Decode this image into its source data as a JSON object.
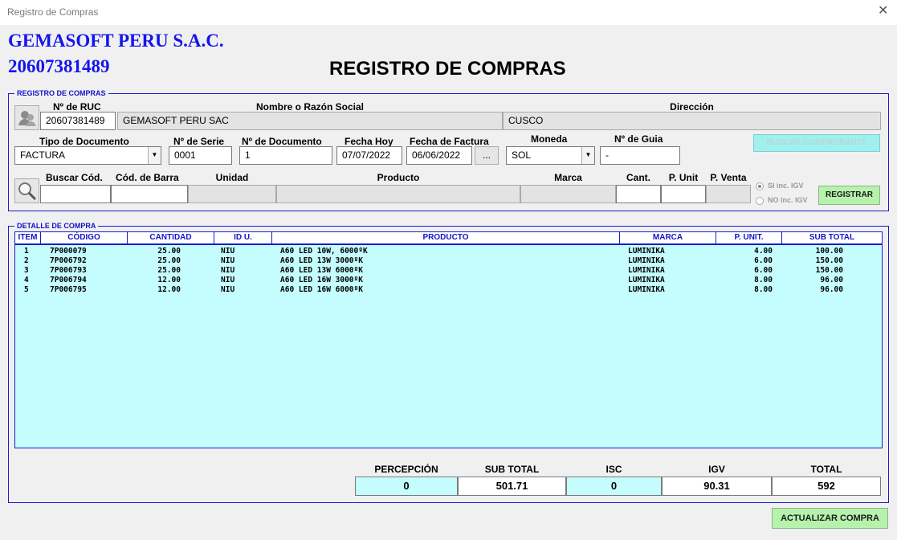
{
  "window": {
    "title": "Registro de Compras"
  },
  "header": {
    "company": "GEMASOFT PERU S.A.C.",
    "ruc": "20607381489",
    "title": "REGISTRO DE COMPRAS"
  },
  "registro": {
    "legend": "REGISTRO DE COMPRAS",
    "ruc_label": "Nº de RUC",
    "ruc_value": "20607381489",
    "razon_label": "Nombre o Razón Social",
    "razon_value": "GEMASOFT PERU SAC",
    "direccion_label": "Dirección",
    "direccion_value": "CUSCO",
    "tipo_label": "Tipo de Documento",
    "tipo_value": "FACTURA",
    "serie_label": "Nº de Serie",
    "serie_value": "0001",
    "documento_label": "Nº de Documento",
    "documento_value": "1",
    "fecha_hoy_label": "Fecha Hoy",
    "fecha_hoy_value": "07/07/2022",
    "fecha_factura_label": "Fecha de Factura",
    "fecha_factura_value": "06/06/2022",
    "fecha_btn": "...",
    "moneda_label": "Moneda",
    "moneda_value": "SOL",
    "guia_label": "Nº de Guia",
    "guia_value": "-",
    "buscar_comprobante": "BUSCAR COMPROBANTE",
    "buscar_cod_label": "Buscar Cód.",
    "barra_label": "Cód. de Barra",
    "unidad_label": "Unidad",
    "producto_label": "Producto",
    "marca_label": "Marca",
    "cant_label": "Cant.",
    "punit_label": "P. Unit",
    "pventa_label": "P. Venta",
    "igv_si": "SI inc. IGV",
    "igv_no": "NO inc. IGV",
    "registrar": "REGISTRAR"
  },
  "detalle": {
    "legend": "DETALLE DE COMPRA",
    "columns": [
      "ITEM",
      "CÓDIGO",
      "CANTIDAD",
      "ID U.",
      "PRODUCTO",
      "MARCA",
      "P. UNIT.",
      "SUB TOTAL"
    ],
    "rows": [
      {
        "item": "1",
        "codigo": "7P000079",
        "cantidad": "25.00",
        "idu": "NIU",
        "producto": "A60 LED 10W, 6000ºK",
        "marca": "LUMINIKA",
        "punit": "4.00",
        "subtotal": "100.00"
      },
      {
        "item": "2",
        "codigo": "7P006792",
        "cantidad": "25.00",
        "idu": "NIU",
        "producto": "A60 LED 13W 3000ºK",
        "marca": "LUMINIKA",
        "punit": "6.00",
        "subtotal": "150.00"
      },
      {
        "item": "3",
        "codigo": "7P006793",
        "cantidad": "25.00",
        "idu": "NIU",
        "producto": "A60 LED 13W 6000ºK",
        "marca": "LUMINIKA",
        "punit": "6.00",
        "subtotal": "150.00"
      },
      {
        "item": "4",
        "codigo": "7P006794",
        "cantidad": "12.00",
        "idu": "NIU",
        "producto": "A60 LED 16W 3000ºK",
        "marca": "LUMINIKA",
        "punit": "8.00",
        "subtotal": "96.00"
      },
      {
        "item": "5",
        "codigo": "7P006795",
        "cantidad": "12.00",
        "idu": "NIU",
        "producto": "A60 LED 16W 6000ºK",
        "marca": "LUMINIKA",
        "punit": "8.00",
        "subtotal": "96.00"
      }
    ]
  },
  "totals": {
    "percepcion_label": "PERCEPCIÓN",
    "percepcion": "0",
    "subtotal_label": "SUB TOTAL",
    "subtotal": "501.71",
    "isc_label": "ISC",
    "isc": "0",
    "igv_label": "IGV",
    "igv": "90.31",
    "total_label": "TOTAL",
    "total": "592"
  },
  "actions": {
    "actualizar": "ACTUALIZAR COMPRA"
  },
  "colors": {
    "accent": "#1414ee",
    "grid_bg": "#c5fcfd",
    "button_green": "#b7f2ad"
  }
}
